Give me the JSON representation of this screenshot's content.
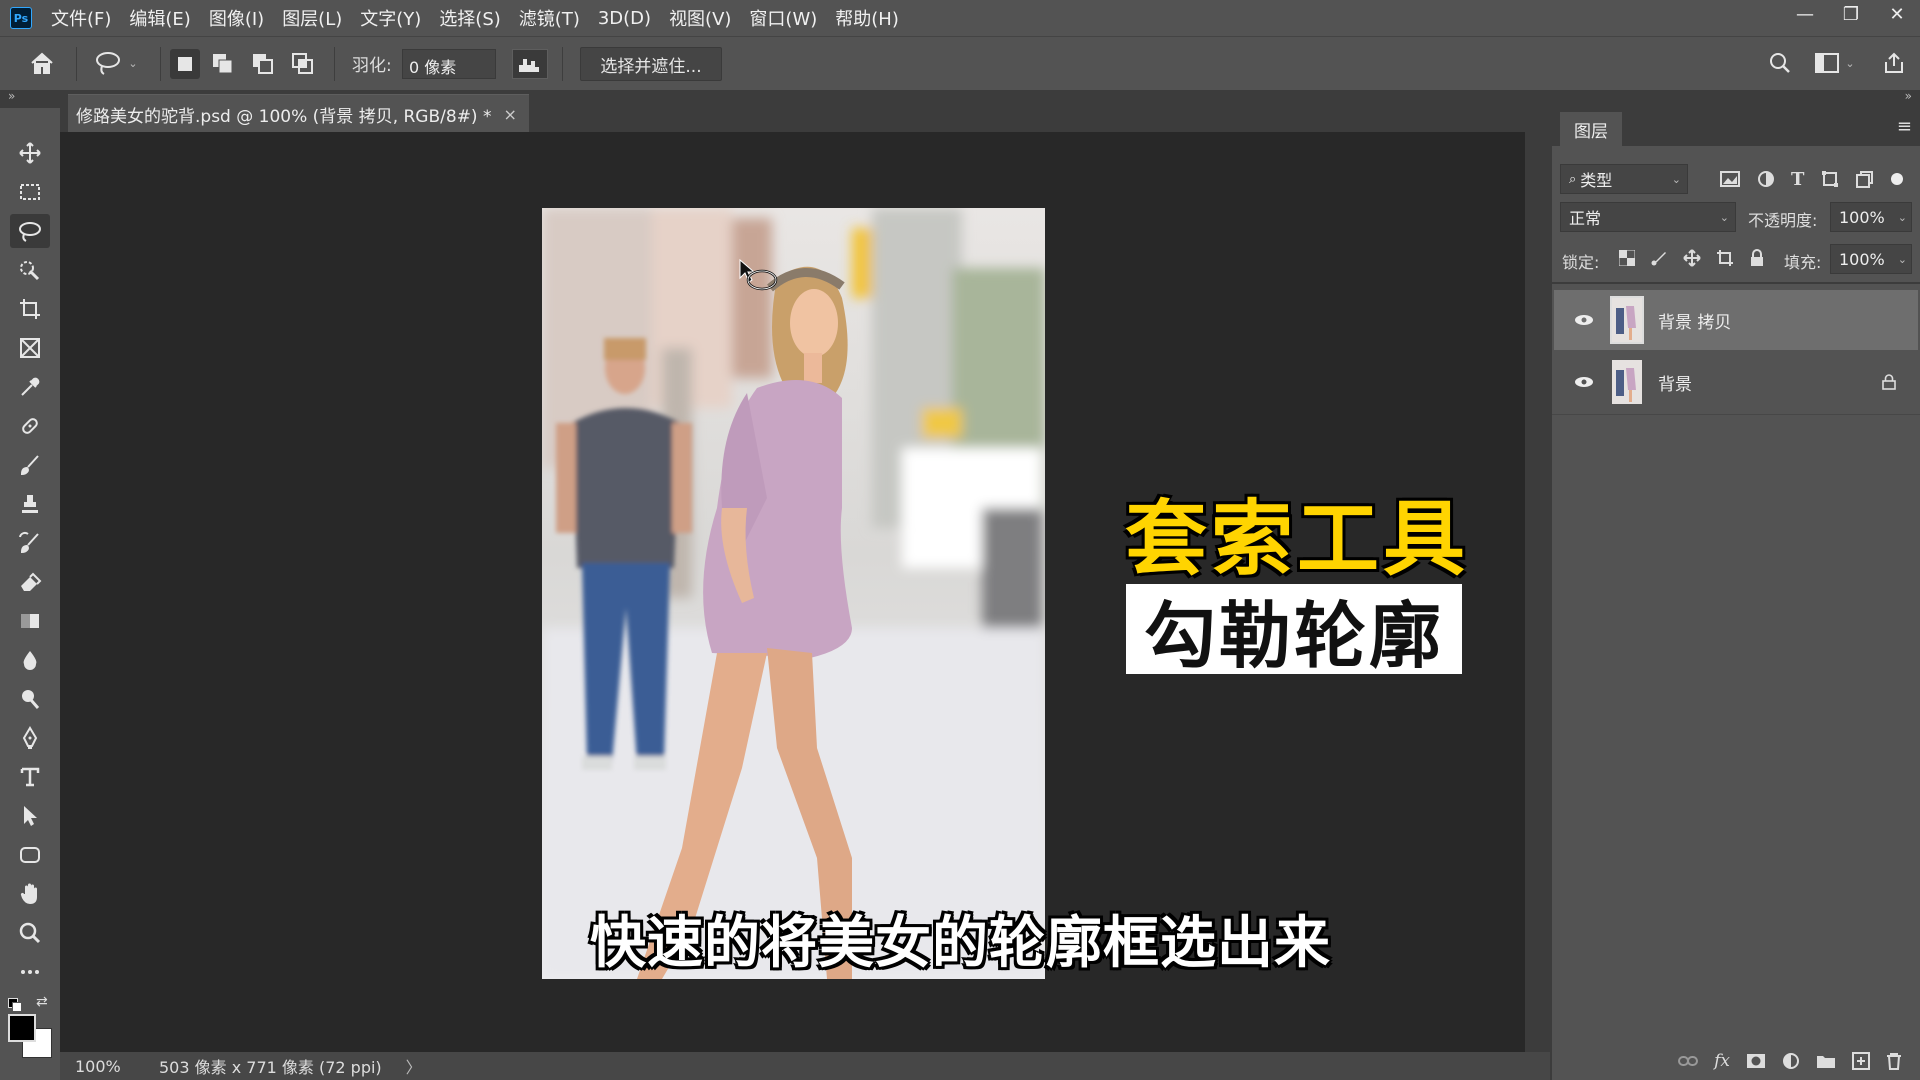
{
  "app": {
    "logo_text": "Ps"
  },
  "menu": [
    "文件(F)",
    "编辑(E)",
    "图像(I)",
    "图层(L)",
    "文字(Y)",
    "选择(S)",
    "滤镜(T)",
    "3D(D)",
    "视图(V)",
    "窗口(W)",
    "帮助(H)"
  ],
  "window_controls": {
    "minimize": "—",
    "restore": "❐",
    "close": "✕"
  },
  "options": {
    "feather_label": "羽化:",
    "feather_value": "0 像素",
    "select_mask_label": "选择并遮住..."
  },
  "document": {
    "tab_title": "修路美女的驼背.psd @ 100% (背景 拷贝, RGB/8#) *",
    "close_glyph": "×"
  },
  "status": {
    "zoom": "100%",
    "doc_info": "503 像素 x 771 像素 (72 ppi)",
    "arrow": "〉"
  },
  "tools": [
    {
      "name": "move-tool",
      "icon": "move-icon"
    },
    {
      "name": "marquee-tool",
      "icon": "marquee-icon"
    },
    {
      "name": "lasso-tool",
      "icon": "lasso-icon",
      "active": true
    },
    {
      "name": "quick-selection-tool",
      "icon": "quick-select-icon"
    },
    {
      "name": "crop-tool",
      "icon": "crop-icon"
    },
    {
      "name": "frame-tool",
      "icon": "frame-icon"
    },
    {
      "name": "eyedropper-tool",
      "icon": "eyedropper-icon"
    },
    {
      "name": "healing-tool",
      "icon": "healing-icon"
    },
    {
      "name": "brush-tool",
      "icon": "brush-icon"
    },
    {
      "name": "stamp-tool",
      "icon": "stamp-icon"
    },
    {
      "name": "history-brush-tool",
      "icon": "history-brush-icon"
    },
    {
      "name": "eraser-tool",
      "icon": "eraser-icon"
    },
    {
      "name": "gradient-tool",
      "icon": "gradient-icon"
    },
    {
      "name": "blur-tool",
      "icon": "blur-icon"
    },
    {
      "name": "dodge-tool",
      "icon": "dodge-icon"
    },
    {
      "name": "pen-tool",
      "icon": "pen-icon"
    },
    {
      "name": "type-tool",
      "icon": "type-icon"
    },
    {
      "name": "path-selection-tool",
      "icon": "path-select-icon"
    },
    {
      "name": "shape-tool",
      "icon": "shape-icon"
    },
    {
      "name": "hand-tool",
      "icon": "hand-icon"
    },
    {
      "name": "zoom-tool",
      "icon": "zoom-icon"
    },
    {
      "name": "more-tools",
      "icon": "more-icon"
    }
  ],
  "layers_panel": {
    "tab_label": "图层",
    "filter_label": "类型",
    "blend_mode": "正常",
    "opacity_label": "不透明度:",
    "opacity_value": "100%",
    "lock_label": "锁定:",
    "fill_label": "填充:",
    "fill_value": "100%",
    "layers": [
      {
        "name": "背景 拷贝",
        "selected": true,
        "locked": false
      },
      {
        "name": "背景",
        "selected": false,
        "locked": true
      }
    ]
  },
  "overlay": {
    "title": "套索工具",
    "subtitle": "勾勒轮廓",
    "caption": "快速的将美女的轮廓框选出来"
  },
  "colors": {
    "ui_dark": "#535353",
    "canvas_bg": "#282828",
    "title_yellow": "#ffd400",
    "foreground": "#000000",
    "background": "#ffffff"
  }
}
